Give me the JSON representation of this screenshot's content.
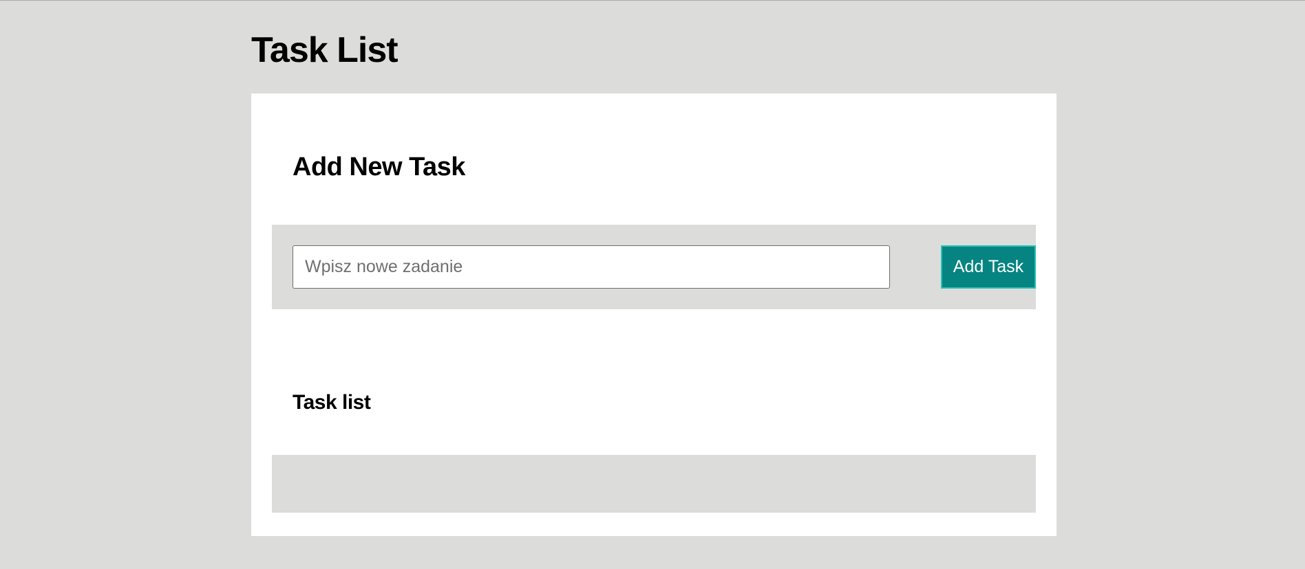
{
  "page": {
    "title": "Task List"
  },
  "add_section": {
    "heading": "Add New Task",
    "input_placeholder": "Wpisz nowe zadanie",
    "input_value": "",
    "button_label": "Add Task"
  },
  "list_section": {
    "heading": "Task list",
    "items": []
  },
  "colors": {
    "page_background": "#dcdcdb",
    "card_background": "#ffffff",
    "panel_background": "#dcdcdb",
    "button_background": "#058481",
    "button_border": "#27c2b8",
    "button_text": "#ffffff"
  }
}
